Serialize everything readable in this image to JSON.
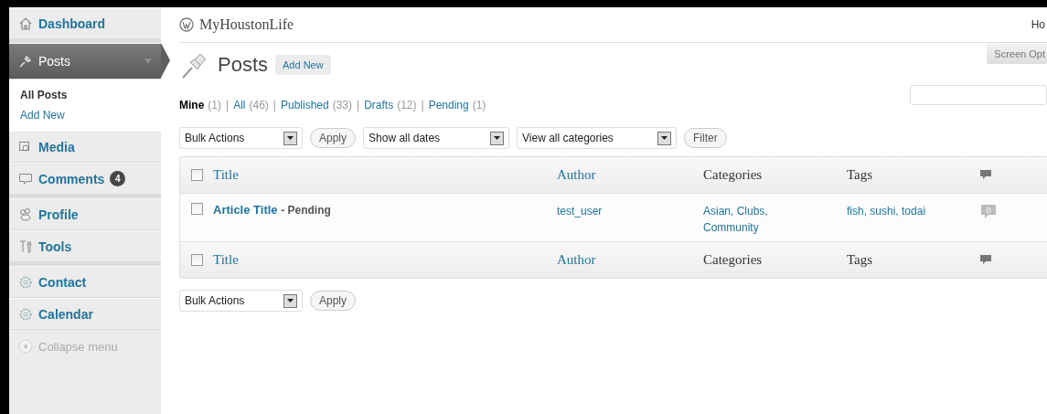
{
  "sidebar": {
    "groups": [
      [
        {
          "label": "Dashboard",
          "selected": false
        }
      ],
      [
        {
          "label": "Posts",
          "selected": true,
          "expanded": true,
          "children": [
            {
              "label": "All Posts",
              "selected": true
            },
            {
              "label": "Add New",
              "selected": false
            }
          ]
        },
        {
          "label": "Media",
          "selected": false
        },
        {
          "label": "Comments",
          "selected": false,
          "badge": "4"
        }
      ],
      [
        {
          "label": "Profile",
          "selected": false
        },
        {
          "label": "Tools",
          "selected": false
        }
      ],
      [
        {
          "label": "Contact",
          "selected": false
        },
        {
          "label": "Calendar",
          "selected": false
        }
      ]
    ],
    "collapse": "Collapse menu"
  },
  "header": {
    "site_title": "MyHoustonLife",
    "right_text": "Ho"
  },
  "screen_options": "Screen Opt",
  "page": {
    "title": "Posts",
    "add_new": "Add New"
  },
  "filter_separator": "|",
  "filters": [
    {
      "label": "Mine",
      "count": "(1)",
      "selected": true
    },
    {
      "label": "All",
      "count": "(46)",
      "selected": false
    },
    {
      "label": "Published",
      "count": "(33)",
      "selected": false
    },
    {
      "label": "Drafts",
      "count": "(12)",
      "selected": false
    },
    {
      "label": "Pending",
      "count": "(1)",
      "selected": false
    }
  ],
  "top_toolbar": {
    "selects": [
      "Bulk Actions",
      "Show all dates",
      "View all categories"
    ],
    "buttons": [
      "Apply",
      "Filter"
    ]
  },
  "table": {
    "columns": [
      "Title",
      "Author",
      "Categories",
      "Tags"
    ],
    "header": {
      "checked": false
    },
    "rows": [
      {
        "checked": false,
        "title": "Article Title",
        "status": "- Pending",
        "author": "test_user",
        "categories": "Asian, Clubs, Community",
        "tags": "fish, sushi, todai",
        "comments": "0"
      }
    ],
    "footer": {
      "checked": false,
      "columns": [
        "Title",
        "Author",
        "Categories",
        "Tags"
      ]
    }
  },
  "bottom_toolbar": {
    "select": "Bulk Actions",
    "button": "Apply"
  }
}
